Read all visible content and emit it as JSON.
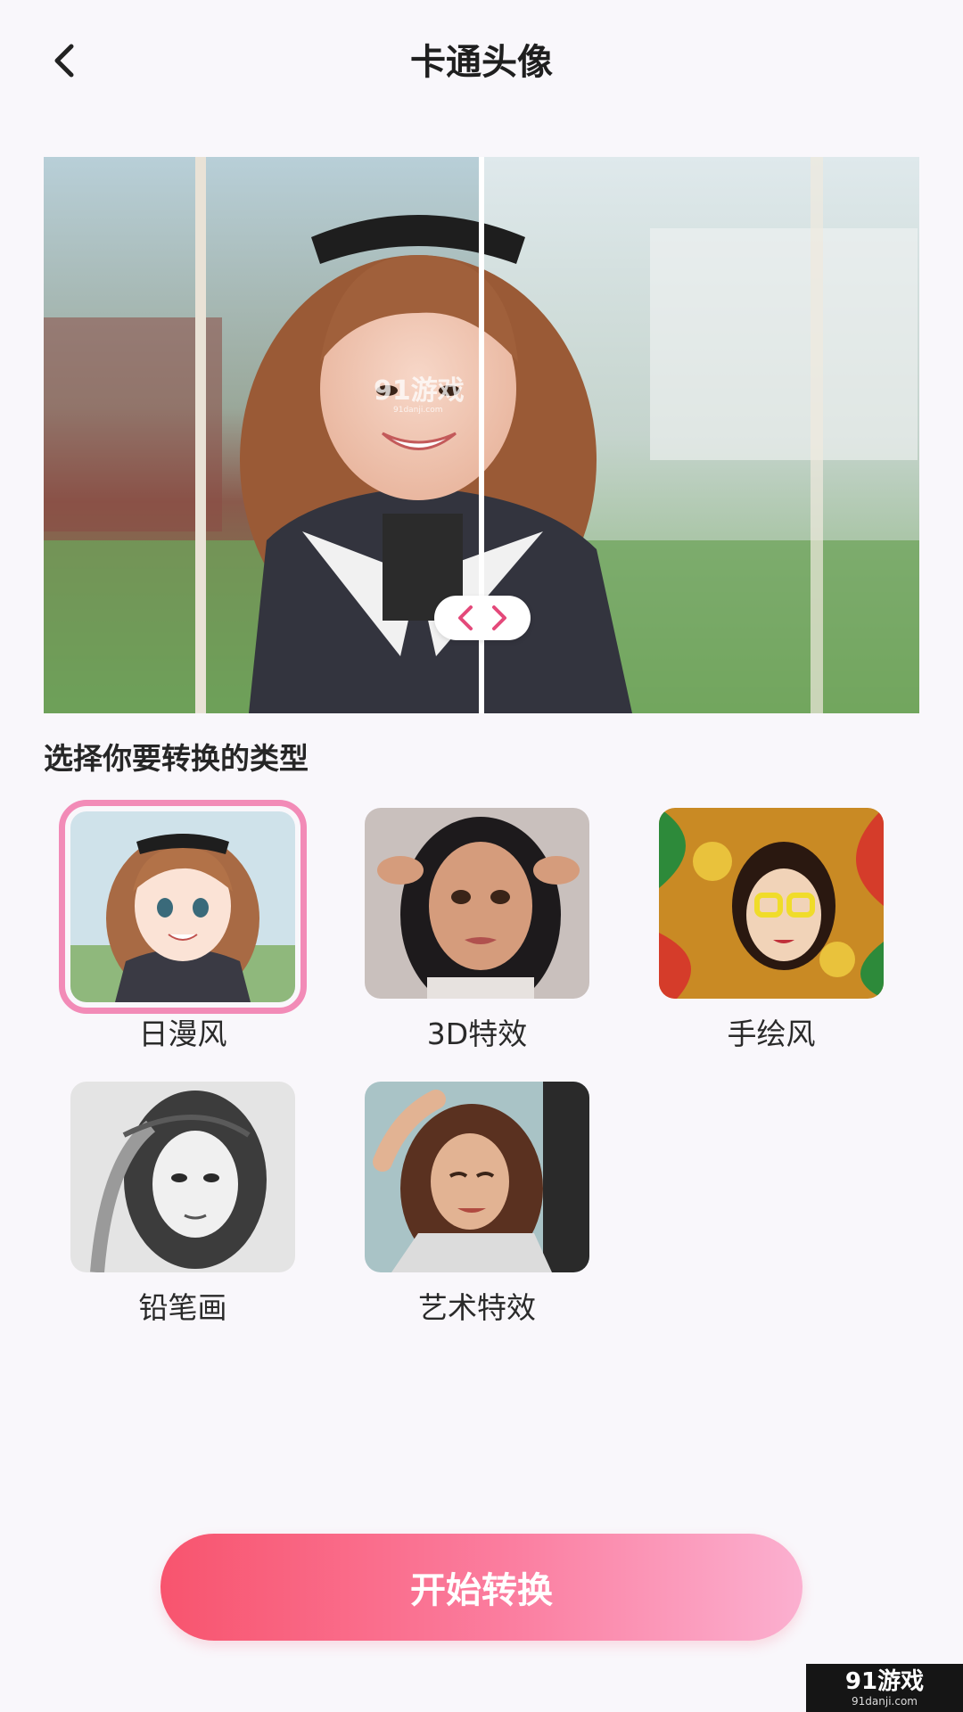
{
  "header": {
    "title": "卡通头像"
  },
  "preview": {
    "image_watermark": "91游戏",
    "image_watermark_sub": "91danji.com"
  },
  "section": {
    "title": "选择你要转换的类型"
  },
  "styles": [
    {
      "label": "日漫风",
      "selected": true
    },
    {
      "label": "3D特效",
      "selected": false
    },
    {
      "label": "手绘风",
      "selected": false
    },
    {
      "label": "铅笔画",
      "selected": false
    },
    {
      "label": "艺术特效",
      "selected": false
    }
  ],
  "actions": {
    "start_label": "开始转换"
  },
  "watermark": {
    "logo": "91游戏",
    "url": "91danji.com"
  },
  "colors": {
    "accent": "#f8546e",
    "accent_light": "#fbb0d0",
    "selected_border": "#f28bb7",
    "handle_arrow": "#e4497a"
  },
  "icons": {
    "back": "chevron-left-icon",
    "compare_left": "chevron-left-icon",
    "compare_right": "chevron-right-icon"
  }
}
